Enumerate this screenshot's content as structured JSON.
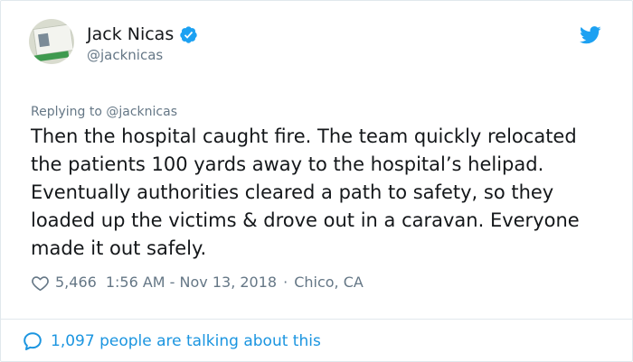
{
  "tweet": {
    "author": {
      "display_name": "Jack Nicas",
      "handle": "@jacknicas",
      "verified": true
    },
    "replying_to": "Replying to @jacknicas",
    "text": "Then the hospital caught fire. The team quickly relocated the patients 100 yards away to the hospital’s helipad. Eventually authorities cleared a path to safety, so they loaded up the victims & drove out in a caravan. Everyone made it out safely.",
    "likes": "5,466",
    "timestamp": "1:56 AM - Nov 13, 2018",
    "separator": "·",
    "location": "Chico, CA",
    "talking_about": "1,097 people are talking about this"
  },
  "colors": {
    "text": "#14171a",
    "muted": "#657786",
    "accent": "#1b95e0",
    "twitter_blue": "#1da1f2",
    "border": "#e1e8ed"
  },
  "icons": {
    "verified": "verified-badge-icon",
    "logo": "twitter-bird-icon",
    "like": "heart-icon",
    "reply": "speech-bubble-icon"
  }
}
